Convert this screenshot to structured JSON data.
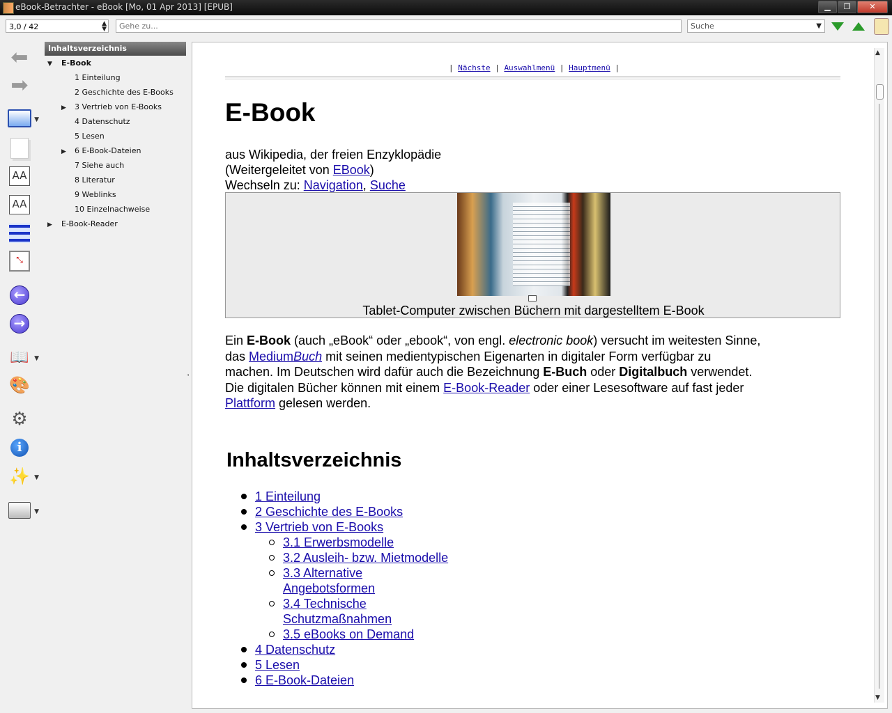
{
  "window": {
    "title": "eBook-Betrachter - eBook [Mo, 01 Apr 2013] [EPUB]"
  },
  "toolbar": {
    "page_value": "3,0 / 42",
    "goto_placeholder": "Gehe zu...",
    "search_placeholder": "Suche"
  },
  "sidebar": {
    "header": "Inhaltsverzeichnis",
    "items": [
      {
        "label": "E-Book",
        "toggle": "▼"
      },
      {
        "label": "1 Einteilung",
        "toggle": ""
      },
      {
        "label": "2 Geschichte des E-Books",
        "toggle": ""
      },
      {
        "label": "3 Vertrieb von E-Books",
        "toggle": "▶"
      },
      {
        "label": "4 Datenschutz",
        "toggle": ""
      },
      {
        "label": "5 Lesen",
        "toggle": ""
      },
      {
        "label": "6 E-Book-Dateien",
        "toggle": "▶"
      },
      {
        "label": "7 Siehe auch",
        "toggle": ""
      },
      {
        "label": "8 Literatur",
        "toggle": ""
      },
      {
        "label": "9 Weblinks",
        "toggle": ""
      },
      {
        "label": "10 Einzelnachweise",
        "toggle": ""
      },
      {
        "label": "E-Book-Reader",
        "toggle": "▶"
      }
    ]
  },
  "doc": {
    "nav": {
      "sep": "|",
      "next": "Nächste",
      "select_menu": "Auswahlmenü",
      "main_menu": "Hauptmenü"
    },
    "title": "E-Book",
    "subline1": "aus Wi­ki­pe­dia, der frei­en En­zy­klo­pä­die",
    "subline2_pre": "(Wei­ter­ge­lei­tet von ",
    "subline2_link": "EBook",
    "subline2_post": ")",
    "subline3_pre": "Wech­seln zu: ",
    "subline3_link1": "Na­vi­ga­ti­on",
    "subline3_sep": ", ",
    "subline3_link2": "Suche",
    "caption": "Ta­blet-Com­pu­ter zwi­schen Bü­chern mit dar­ge­stell­tem E-Book",
    "intro": {
      "l1_a": "Ein ",
      "l1_b": "E-Book",
      "l1_c": " (auch „eBook“ oder „ebook“, von engl. ",
      "l1_d": "elec­tro­nic book",
      "l1_e": ") ver­sucht im wei­tes­ten Sinne,",
      "l2_a": "das ",
      "l2_link1": "Me­di­um",
      "l2_link2": "Buch",
      "l2_b": " mit sei­nen me­di­en­ty­pi­schen Ei­gen­ar­ten in di­gi­ta­ler Form ver­füg­bar zu",
      "l3_a": "ma­chen. Im Deut­schen wird dafür auch die Be­zeich­nung ",
      "l3_b": "E-Buch",
      "l3_c": " oder ",
      "l3_d": "Digitalbuch",
      "l3_e": " ver­wen­det.",
      "l4_a": "Die di­gi­ta­len Bü­cher kön­nen mit einem ",
      "l4_link": "E-Book-Rea­der",
      "l4_b": " oder einer Le­se­soft­ware auf fast jeder",
      "l5_link": "Platt­form",
      "l5_b": " ge­le­sen wer­den."
    },
    "toc_heading": "Inhaltsverzeichnis",
    "toc": [
      {
        "label": "1 Ein­tei­lung",
        "level": 1
      },
      {
        "label": "2 Ge­schich­te des E-Books",
        "level": 1
      },
      {
        "label": "3 Ver­trieb von E-Books",
        "level": 1
      },
      {
        "label": "3.1 Er­werbs­mo­del­le",
        "level": 2
      },
      {
        "label": "3.2 Aus­leih- bzw. Miet­mo­del­le",
        "level": 2
      },
      {
        "label": "3.3 Al­ter­na­ti­ve",
        "label2": "An­ge­bots­for­men",
        "level": 2
      },
      {
        "label": "3.4 Tech­ni­sche",
        "label2": "Schutz­maß­nah­men",
        "level": 2
      },
      {
        "label": "3.5 eBooks on De­mand",
        "level": 2
      },
      {
        "label": "4 Da­ten­schutz",
        "level": 1
      },
      {
        "label": "5 Lesen",
        "level": 1
      },
      {
        "label": "6 E-Book-Da­tei­en",
        "level": 1
      }
    ]
  },
  "colors": {
    "link": "#1a0dab",
    "accent_green": "#2a9a2a",
    "sidebar_header": "#4b4b4b"
  },
  "icons": [
    "back-arrow-icon",
    "forward-arrow-icon",
    "monitor-icon",
    "pages-icon",
    "font-larger-icon",
    "font-smaller-icon",
    "toc-bars-icon",
    "fit-page-icon",
    "prev-circle-icon",
    "next-circle-icon",
    "bookmark-book-icon",
    "paint-icon",
    "gear-icon",
    "info-icon",
    "wand-icon",
    "printer-icon"
  ]
}
